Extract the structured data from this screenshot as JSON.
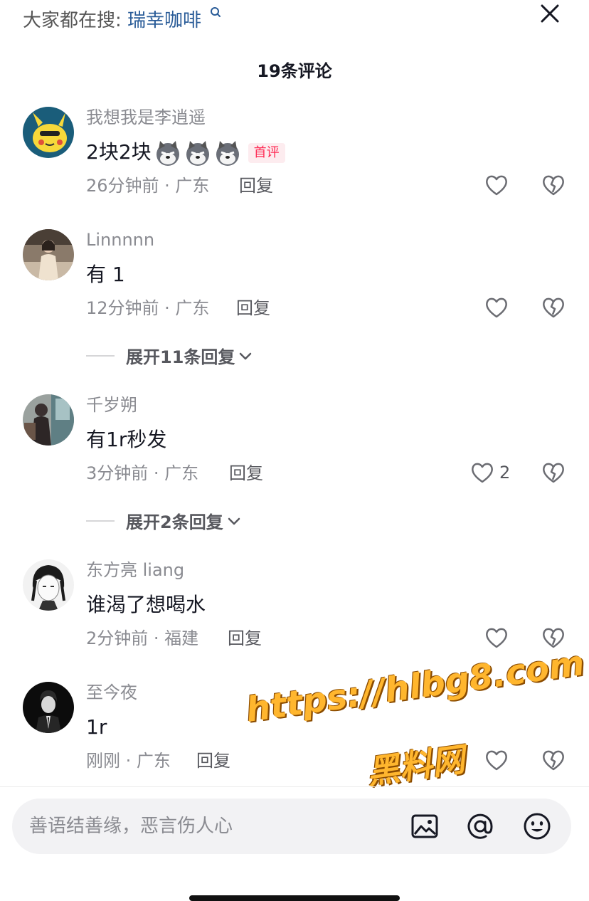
{
  "header": {
    "search_prefix": "大家都在搜:",
    "search_keyword": "瑞幸咖啡",
    "comment_count": "19条评论"
  },
  "comments": [
    {
      "username": "我想我是李逍遥",
      "text": "2块2块",
      "emoji": [
        "husky-emoji",
        "husky-emoji",
        "husky-emoji"
      ],
      "badge": "首评",
      "time_location": "26分钟前 · 广东",
      "reply_label": "回复",
      "likes": ""
    },
    {
      "username": "Linnnnn",
      "text": "有  1",
      "time_location": "12分钟前 · 广东",
      "reply_label": "回复",
      "likes": "",
      "expand_label": "展开11条回复"
    },
    {
      "username": "千岁朔",
      "text": "有1r秒发",
      "time_location": "3分钟前 · 广东",
      "reply_label": "回复",
      "likes": "2",
      "expand_label": "展开2条回复"
    },
    {
      "username": "东方亮 liang",
      "text": "谁渴了想喝水",
      "time_location": "2分钟前 · 福建",
      "reply_label": "回复",
      "likes": ""
    },
    {
      "username": "至今夜",
      "text": "1r",
      "time_location": "刚刚 · 广东",
      "reply_label": "回复",
      "likes": ""
    }
  ],
  "watermark": {
    "url": "https://hlbg8.com",
    "name": "黑料网"
  },
  "input": {
    "placeholder": "善语结善缘，恶言伤人心"
  },
  "icons": {
    "close": "close-icon",
    "search": "search-icon",
    "like": "heart-icon",
    "dislike": "broken-heart-icon",
    "image": "image-icon",
    "mention": "at-icon",
    "emoji": "emoji-icon"
  },
  "colors": {
    "accent_link": "#2a5c98",
    "badge_text": "#fe2c55",
    "badge_bg": "#fdecef",
    "watermark": "#ffb62e"
  }
}
